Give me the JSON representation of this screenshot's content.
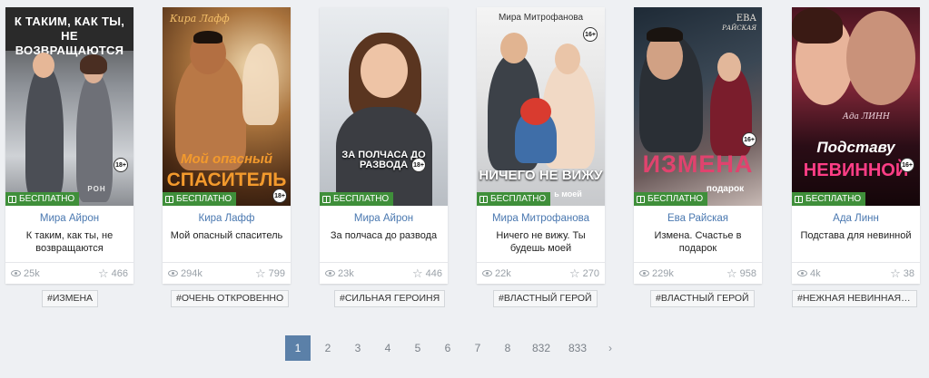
{
  "books": [
    {
      "cover_head": "К ТАКИМ, КАК ТЫ, НЕ ВОЗВРАЩАЮТСЯ",
      "cover_bottom": "РОН",
      "age": "18+",
      "badge": "БЕСПЛАТНО",
      "author": "Мира Айрон",
      "title": "К таким, как ты, не возвращаются",
      "views": "25k",
      "stars": "466",
      "tag": "#ИЗМЕНА"
    },
    {
      "cover_author": "Кира Лафф",
      "cover_title_1": "Мой опасный",
      "cover_title_2": "СПАСИТЕЛЬ",
      "age": "18+",
      "badge": "БЕСПЛАТНО",
      "author": "Кира Лафф",
      "title": "Мой опасный спаситель",
      "views": "294k",
      "stars": "799",
      "tag": "#ОЧЕНЬ ОТКРОВЕННО"
    },
    {
      "cover_title": "ЗА ПОЛЧАСА ДО РАЗВОДА",
      "age": "18+",
      "badge": "БЕСПЛАТНО",
      "author": "Мира Айрон",
      "title": "За полчаса до развода",
      "views": "23k",
      "stars": "446",
      "tag": "#СИЛЬНАЯ ГЕРОИНЯ"
    },
    {
      "cover_author": "Мира Митрофанова",
      "cover_title_1": "НИЧЕГО НЕ ВИЖУ",
      "cover_title_2": "ь моей",
      "age": "16+",
      "badge": "БЕСПЛАТНО",
      "author": "Мира Митрофанова",
      "title": "Ничего не вижу. Ты будешь моей",
      "views": "22k",
      "stars": "270",
      "tag": "#ВЛАСТНЫЙ ГЕРОЙ"
    },
    {
      "cover_author_1": "ЕВА",
      "cover_author_2": "РАЙСКАЯ",
      "cover_title_1": "ИЗМЕНА",
      "cover_title_2": "подарок",
      "age": "16+",
      "badge": "БЕСПЛАТНО",
      "author": "Ева Райская",
      "title": "Измена. Счастье в подарок",
      "views": "229k",
      "stars": "958",
      "tag": "#ВЛАСТНЫЙ ГЕРОЙ"
    },
    {
      "cover_author": "Ада ЛИНН",
      "cover_title_1": "Подставу",
      "cover_title_2": "НЕВИННОЙ",
      "age": "16+",
      "badge": "БЕСПЛАТНО",
      "author": "Ада Линн",
      "title": "Подстава для невинной",
      "views": "4k",
      "stars": "38",
      "tag": "#НЕЖНАЯ НЕВИННАЯ ГЕРОИНЯ"
    }
  ],
  "pagination": {
    "pages": [
      "1",
      "2",
      "3",
      "4",
      "5",
      "6",
      "7",
      "8",
      "832",
      "833"
    ],
    "active": "1",
    "next": "›"
  },
  "colors": {
    "background": "#eef0f3",
    "author_link": "#4a78b0",
    "free_badge": "#3f8f3a",
    "pager_active": "#5b80a8"
  }
}
